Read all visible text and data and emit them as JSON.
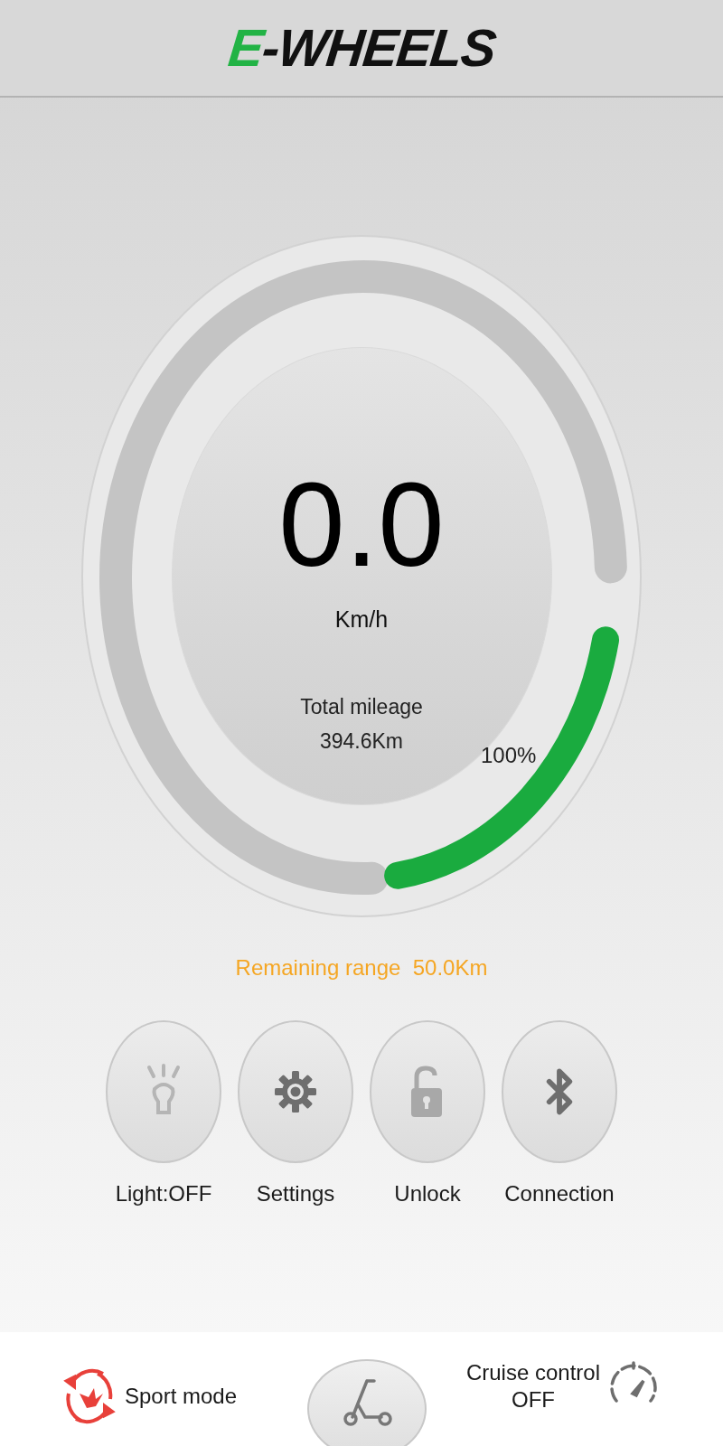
{
  "logo": {
    "accent": "E",
    "text": "-WHEELS"
  },
  "gauge": {
    "speed": "0.0",
    "unit": "Km/h",
    "mileage_label": "Total mileage",
    "mileage": "394.6Km",
    "battery": {
      "reading": "100%"
    }
  },
  "range": "Remaining range  50.0Km",
  "controls": [
    {
      "kind": "light",
      "label": "Light:OFF",
      "on": false
    },
    {
      "kind": "settings",
      "label": "Settings"
    },
    {
      "kind": "lock",
      "label": "Unlock"
    },
    {
      "kind": "bluetooth",
      "label": "Connection"
    }
  ],
  "bottom_bar": {
    "sport_mode": "Sport mode",
    "cruise_control": {
      "label": "Cruise control",
      "value": "OFF"
    }
  }
}
